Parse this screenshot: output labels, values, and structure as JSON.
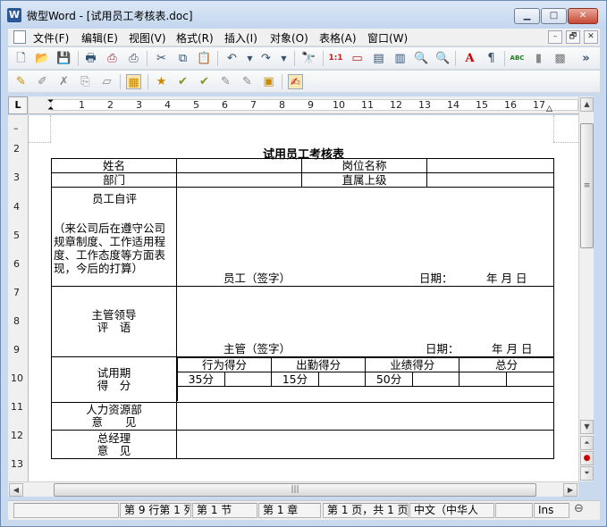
{
  "window": {
    "app_icon": "W",
    "title": "微型Word - [试用员工考核表.doc]"
  },
  "window_controls": {
    "minimize": "▁",
    "maximize": "□",
    "close": "✕"
  },
  "menu": {
    "items": [
      "文件(F)",
      "编辑(E)",
      "视图(V)",
      "格式(R)",
      "插入(I)",
      "对象(O)",
      "表格(A)",
      "窗口(W)"
    ],
    "doc_controls": [
      "–",
      "🗗",
      "✕"
    ]
  },
  "toolbar1": {
    "icons": [
      "new-icon",
      "open-icon",
      "save-icon",
      "print-icon",
      "pdf-icon",
      "cut-icon",
      "copy-icon",
      "paste-icon",
      "undo-icon",
      "redo-icon",
      "find-icon",
      "zoom-100-icon",
      "layout-icon",
      "page-view-icon",
      "two-page-icon",
      "zoom-icon",
      "font-color-icon",
      "format-icon",
      "spellcheck-icon",
      "chart-icon",
      "shape-icon",
      "more-icon"
    ],
    "glyphs": [
      "🗋",
      "📂",
      "💾",
      "🖶",
      "⎙",
      "✂",
      "⧉",
      "📋",
      "↶",
      "↷",
      "🔭",
      "1:1",
      "▭",
      "▤",
      "▥",
      "🔍",
      "A",
      "¶",
      "ABC",
      "▮",
      "▩",
      "»"
    ]
  },
  "toolbar2": {
    "glyphs": [
      "✎",
      "✐",
      "✗",
      "⎘",
      "▱",
      "▦",
      "★",
      "✔",
      "✔",
      "✎",
      "✎",
      "▣",
      "✍"
    ]
  },
  "ruler": {
    "corner": "L",
    "h_numbers": [
      "1",
      "1",
      "2",
      "3",
      "4",
      "5",
      "6",
      "7",
      "8",
      "9",
      "10",
      "11",
      "12",
      "13",
      "14",
      "15",
      "16",
      "17"
    ],
    "v_numbers": [
      "1",
      "2",
      "3",
      "4",
      "5",
      "6",
      "7",
      "8",
      "9",
      "10",
      "11",
      "12",
      "13"
    ]
  },
  "document": {
    "title": "试用员工考核表",
    "row_name": {
      "label": "姓名",
      "value": "",
      "label2": "岗位名称",
      "value2": ""
    },
    "row_dept": {
      "label": "部门",
      "value": "",
      "label2": "直属上级",
      "value2": ""
    },
    "self_eval": {
      "label": "员工自评",
      "hint": "（来公司后在遵守公司规章制度、工作适用程度、工作态度等方面表现，今后的打算）",
      "sign": "员工（签字）",
      "date_label": "日期：",
      "date_value": "年 月 日"
    },
    "manager_eval": {
      "label_line1": "主管领导",
      "label_line2": "评　语",
      "sign": "主管（签字）",
      "date_label": "日期：",
      "date_value": "年 月 日"
    },
    "score": {
      "label_line1": "试用期",
      "label_line2": "得　分",
      "headers": [
        "行为得分",
        "出勤得分",
        "业绩得分",
        "总分"
      ],
      "values": [
        "35分",
        "",
        "15分",
        "",
        "50分",
        "",
        "",
        ""
      ]
    },
    "hr": {
      "label_line1": "人力资源部",
      "label_line2": "意　　见"
    },
    "gm": {
      "label_line1": "总经理",
      "label_line2": "意　见"
    }
  },
  "scrollbars": {
    "up": "▲",
    "down": "▼",
    "page_up": "⏶",
    "page_down": "⏷",
    "select_object": "●",
    "left": "◀",
    "right": "▶",
    "grip": "≡",
    "hgrip": "|||"
  },
  "status": {
    "cells": [
      "",
      "第 9 行第 1 列",
      "第 1 节",
      "第 1 章",
      "第 1 页，共 1 页",
      "中文（中华人",
      "",
      "Ins"
    ],
    "zoom_icon": "⊖"
  }
}
